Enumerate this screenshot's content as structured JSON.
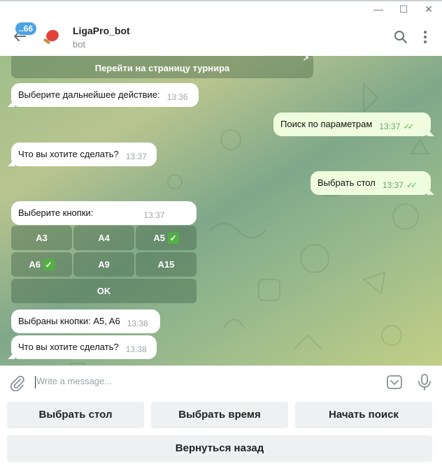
{
  "window": {
    "minimize": "—",
    "maximize": "☐",
    "close": "✕"
  },
  "header": {
    "unread_badge": "..66",
    "bot_name": "LigaPro_bot",
    "bot_status": "bot"
  },
  "chat": {
    "inline_top_button": "Перейти на страницу турнира",
    "inline_top_arrow": "↗",
    "messages": [
      {
        "dir": "in",
        "text": "Выберите дальнейшее действие:",
        "time": "13:36"
      },
      {
        "dir": "out",
        "text": "Поиск по параметрам",
        "time": "13:37",
        "ticks": "✓✓"
      },
      {
        "dir": "in",
        "text": "Что вы хотите сделать?",
        "time": "13:37"
      },
      {
        "dir": "out",
        "text": "Выбрать стол",
        "time": "13:37",
        "ticks": "✓✓"
      },
      {
        "dir": "in",
        "text": "Выберите кнопки:",
        "time": "13:37"
      },
      {
        "dir": "in",
        "text": "Выбраны кнопки: A5, A6",
        "time": "13:38"
      },
      {
        "dir": "in",
        "text": "Что вы хотите сделать?",
        "time": "13:38"
      }
    ],
    "inline_keyboard": [
      {
        "label": "A3",
        "checked": false
      },
      {
        "label": "A4",
        "checked": false
      },
      {
        "label": "A5",
        "checked": true
      },
      {
        "label": "A6",
        "checked": true
      },
      {
        "label": "A9",
        "checked": false
      },
      {
        "label": "A15",
        "checked": false
      },
      {
        "label": "OK",
        "checked": false
      }
    ],
    "check_glyph": "✓"
  },
  "composer": {
    "placeholder": "Write a message..."
  },
  "reply_keyboard": {
    "row1": [
      "Выбрать стол",
      "Выбрать время",
      "Начать поиск"
    ],
    "row2": [
      "Вернуться назад"
    ]
  },
  "colors": {
    "accent": "#4ca3e3",
    "outgoing_bubble": "#effdde",
    "incoming_bubble": "#ffffff",
    "check_green": "#52b043"
  }
}
